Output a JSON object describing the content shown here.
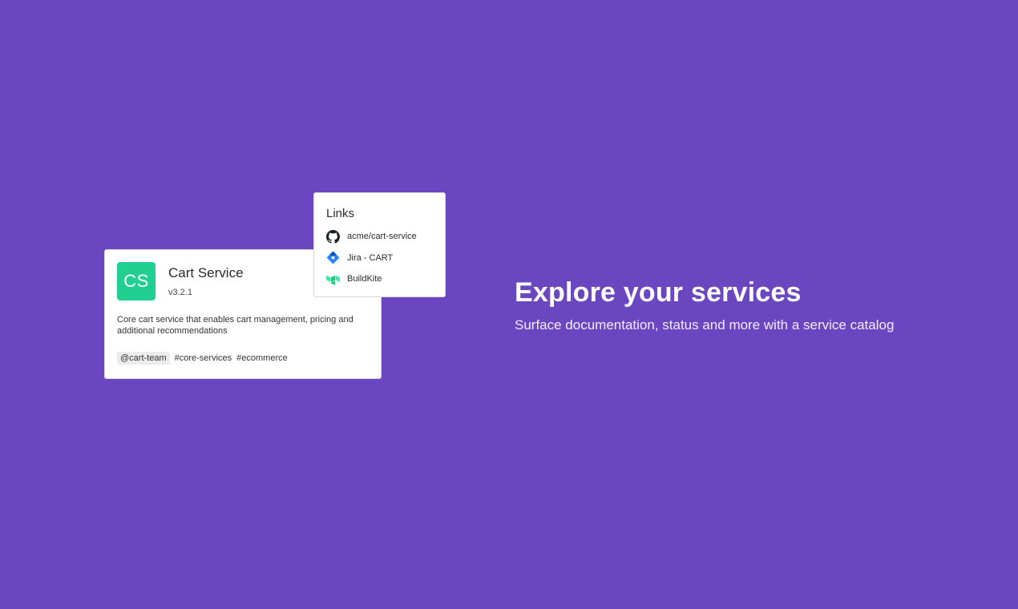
{
  "colors": {
    "background": "#6b46c1",
    "avatar": "#21cf91",
    "github": "#1b1f23",
    "jira": "#2684ff",
    "buildkite": "#30f2a2"
  },
  "service_card": {
    "avatar_initials": "CS",
    "name": "Cart Service",
    "version": "v3.2.1",
    "description": "Core cart service that enables cart management, pricing and additional recommendations",
    "owner_tag": "@cart-team",
    "tags": [
      "#core-services",
      "#ecommerce"
    ]
  },
  "links_card": {
    "title": "Links",
    "items": [
      {
        "label": "acme/cart-service",
        "icon": "github-icon"
      },
      {
        "label": "Jira - CART",
        "icon": "jira-icon"
      },
      {
        "label": "BuildKite",
        "icon": "buildkite-icon"
      }
    ]
  },
  "hero": {
    "title": "Explore your services",
    "subtitle": "Surface documentation, status and more with a service catalog"
  }
}
